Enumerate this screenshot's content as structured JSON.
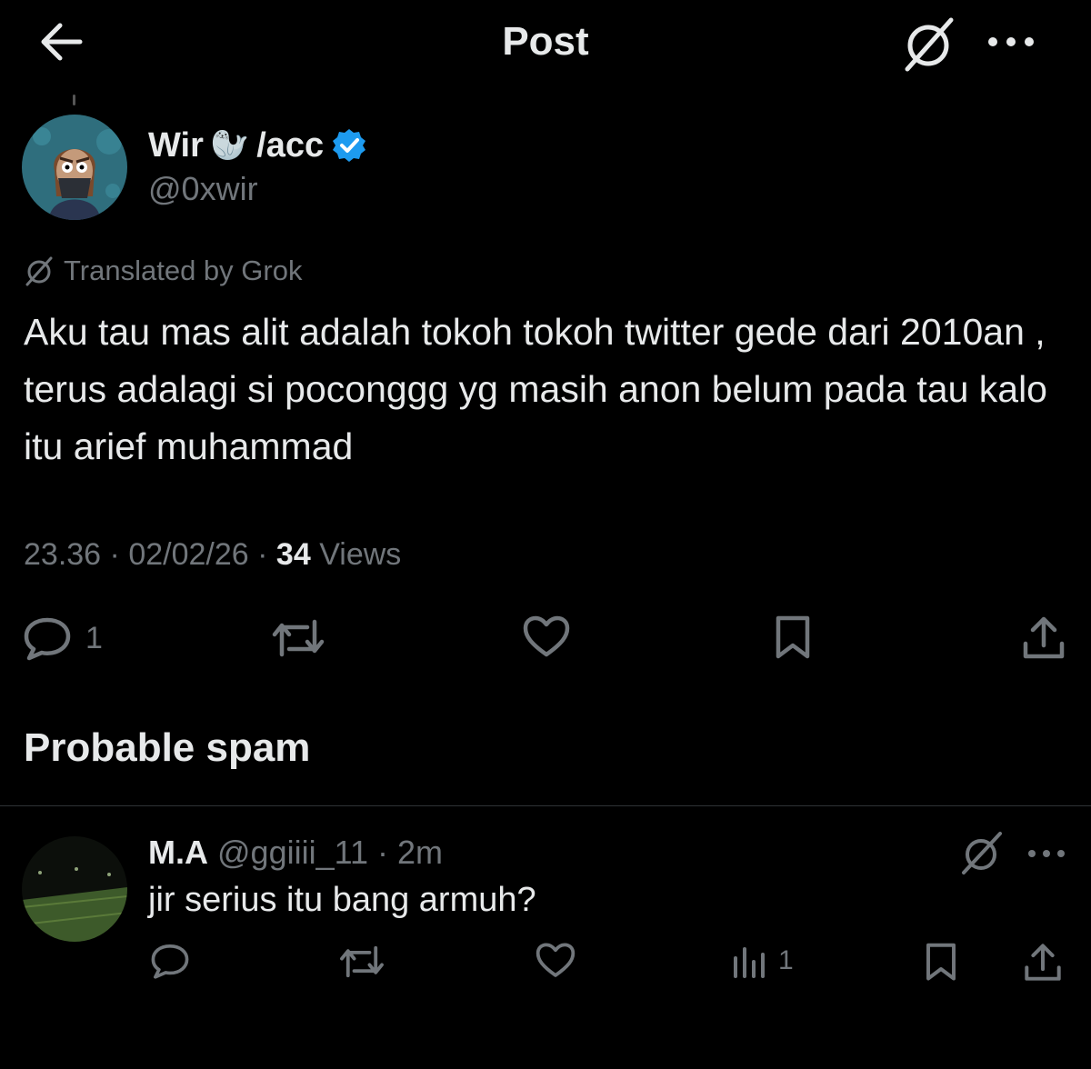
{
  "header": {
    "title": "Post"
  },
  "author": {
    "name": "Wir",
    "name_emoji": "🦭",
    "name_suffix": "/acc",
    "handle": "@0xwir"
  },
  "post": {
    "translated_label": "Translated by Grok",
    "text": "Aku tau mas alit adalah tokoh tokoh twitter gede dari 2010an , terus adalagi si poconggg yg masih anon belum pada tau kalo itu arief muhammad",
    "time": "23.36",
    "date": "02/02/26",
    "views_count": "34",
    "views_label": "Views",
    "separator": "·"
  },
  "actions": {
    "reply_count": "1"
  },
  "section": {
    "spam_heading": "Probable spam"
  },
  "reply": {
    "name": "M.A",
    "handle": "@ggiiii_11",
    "separator": "·",
    "time": "2m",
    "text": "jir serius itu bang armuh?",
    "views_count": "1"
  },
  "colors": {
    "background": "#000000",
    "text_primary": "#e7e9ea",
    "text_secondary": "#71767b",
    "verified": "#1d9bf0",
    "divider": "#2f3336"
  },
  "icons": {
    "back": "arrow-left-icon",
    "grok": "grok-icon",
    "more": "more-horizontal-icon",
    "verified": "verified-badge-icon",
    "reply": "reply-icon",
    "retweet": "retweet-icon",
    "like": "heart-icon",
    "bookmark": "bookmark-icon",
    "share": "share-icon",
    "views": "views-chart-icon"
  }
}
